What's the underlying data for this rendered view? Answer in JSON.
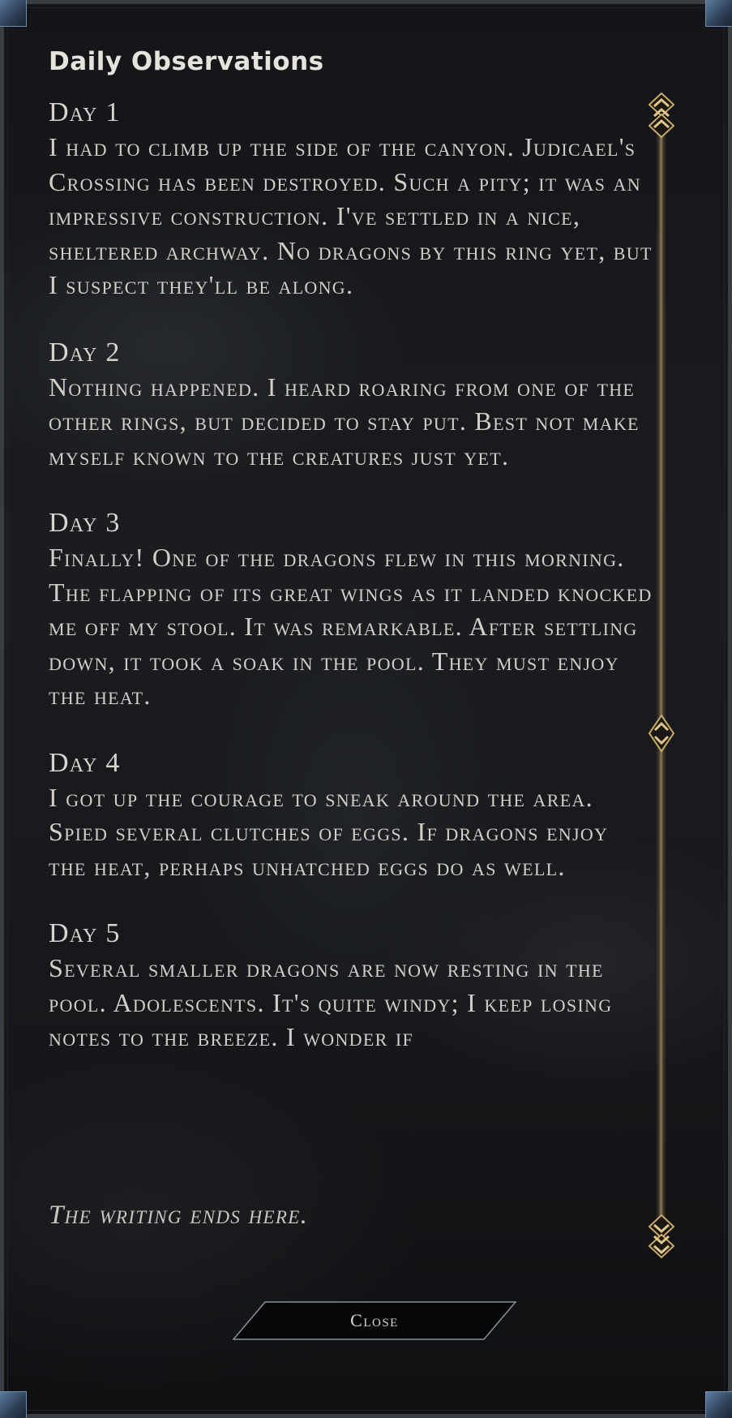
{
  "panel": {
    "title": "Daily Observations"
  },
  "entries": [
    {
      "day": "Day 1",
      "text": "I had to climb up the side of the canyon. Judicael's Crossing has been destroyed. Such a pity; it was an impressive construction. I've settled in a nice, sheltered archway. No dragons by this ring yet, but I suspect they'll be along."
    },
    {
      "day": "Day 2",
      "text": "Nothing happened. I heard roaring from one of the other rings, but decided to stay put. Best not make myself known to the creatures just yet."
    },
    {
      "day": "Day 3",
      "text": "Finally! One of the dragons flew in this morning. The flapping of its great wings as it landed knocked me off my stool. It was remarkable. After settling down, it took a soak in the pool. They must enjoy the heat."
    },
    {
      "day": "Day 4",
      "text": "I got up the courage to sneak around the area. Spied several clutches of eggs. If dragons enjoy the heat, perhaps unhatched eggs do as well."
    },
    {
      "day": "Day 5",
      "text": "Several smaller dragons are now resting in the pool. Adolescents. It's quite windy; I keep losing notes to the breeze. I wonder if"
    }
  ],
  "ending": "The writing ends here.",
  "buttons": {
    "close_label": "Close"
  },
  "icons": {
    "scroll_up": "double-chevron-up-icon",
    "scroll_down": "double-chevron-down-icon",
    "scroll_thumb": "scroll-thumb-icon"
  },
  "colors": {
    "accent_gold": "#c8a96a",
    "text": "#d3cfc7",
    "frame_blue": "#5d7fa3"
  }
}
